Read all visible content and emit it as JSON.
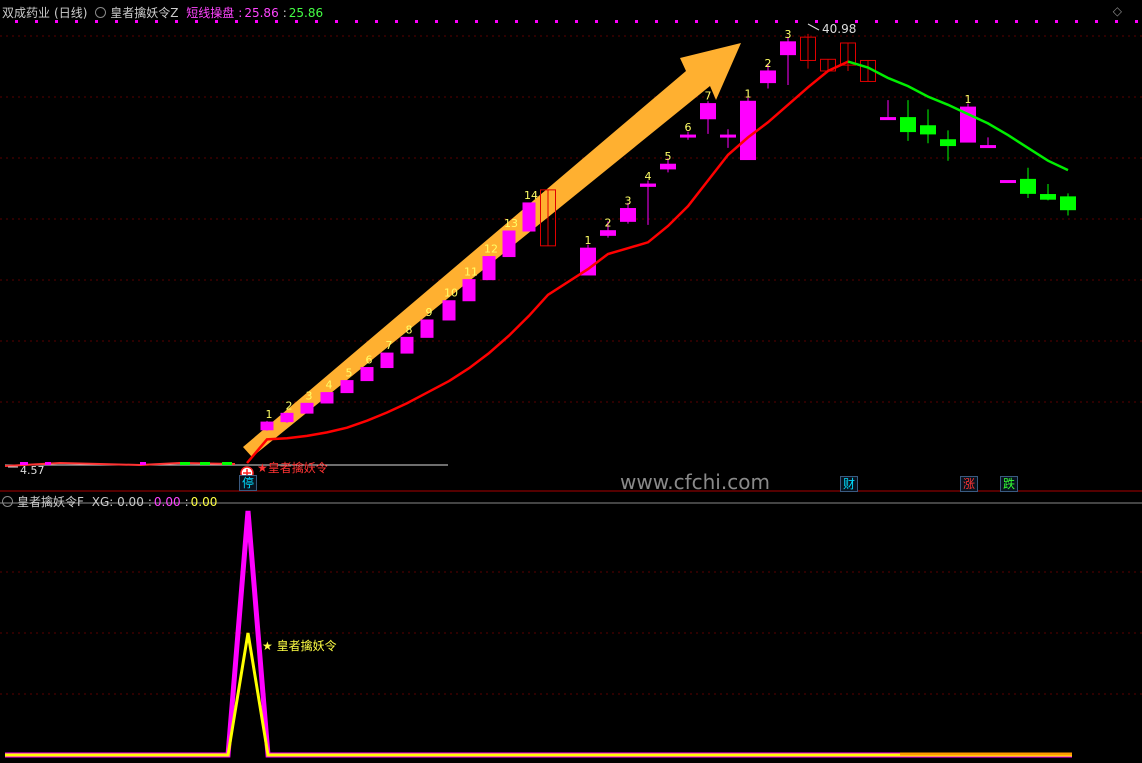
{
  "header": {
    "stock_name": "双成药业",
    "period": "(日线)",
    "indicator_z": "皇者擒妖令Z",
    "short_label": "短线操盘",
    "short_value_1": "25.86",
    "short_value_2": "25.86"
  },
  "sub_header": {
    "indicator_f": "皇者擒妖令F",
    "xg_label": "XG: 0.00",
    "value_2": "0.00",
    "value_3": "0.00"
  },
  "annotations": {
    "high_label": "40.98",
    "low_label": "4.57",
    "signal_label": "★皇者擒妖令",
    "sub_signal_label": "★ 皇者擒妖令",
    "halt_badge": "停",
    "finance_badge": "财",
    "rise_badge": "涨",
    "fall_badge": "跌",
    "watermark": "www.cfchi.com"
  },
  "colors": {
    "background": "#000000",
    "grid": "#5a0000",
    "up_candle": "#ff00ff",
    "down_candle": "#00ff00",
    "ma_up": "#ff0000",
    "ma_down": "#00ee00",
    "arrow": "#ffb030",
    "signal_magenta": "#ff00ff",
    "signal_yellow": "#ffff00"
  },
  "chart_data": [
    {
      "type": "candlestick",
      "title": "双成药业 (日线)",
      "ylim": [
        4.0,
        42.0
      ],
      "grid": true,
      "candles": [
        {
          "open": 7.02,
          "close": 7.68,
          "high": 7.78,
          "low": 6.94,
          "count": "1"
        },
        {
          "open": 7.72,
          "close": 8.43,
          "high": 8.49,
          "low": 7.6,
          "count": "2"
        },
        {
          "open": 8.45,
          "close": 9.29,
          "high": 9.29,
          "low": 8.45,
          "count": "3"
        },
        {
          "open": 9.32,
          "close": 10.21,
          "high": 10.21,
          "low": 9.32,
          "count": "4"
        },
        {
          "open": 10.21,
          "close": 11.24,
          "high": 11.24,
          "low": 10.21,
          "count": "5"
        },
        {
          "open": 11.24,
          "close": 12.36,
          "high": 12.36,
          "low": 11.24,
          "count": "6"
        },
        {
          "open": 12.36,
          "close": 13.6,
          "high": 13.6,
          "low": 12.36,
          "count": "7"
        },
        {
          "open": 13.6,
          "close": 14.95,
          "high": 14.95,
          "low": 13.6,
          "count": "8"
        },
        {
          "open": 14.95,
          "close": 16.44,
          "high": 16.44,
          "low": 14.95,
          "count": "9"
        },
        {
          "open": 16.44,
          "close": 18.09,
          "high": 18.09,
          "low": 16.44,
          "count": "10"
        },
        {
          "open": 18.09,
          "close": 19.9,
          "high": 19.9,
          "low": 18.09,
          "count": "11"
        },
        {
          "open": 19.9,
          "close": 21.88,
          "high": 21.88,
          "low": 19.9,
          "count": "12"
        },
        {
          "open": 21.88,
          "close": 24.07,
          "high": 24.07,
          "low": 21.88,
          "count": "13"
        },
        {
          "open": 24.07,
          "close": 26.48,
          "high": 26.48,
          "low": 24.07,
          "count": "14"
        },
        {
          "open": 27.6,
          "close": 22.8,
          "high": 27.6,
          "low": 22.8,
          "count": ""
        },
        {
          "open": 20.3,
          "close": 22.6,
          "high": 22.9,
          "low": 20.3,
          "count": "1"
        },
        {
          "open": 23.7,
          "close": 24.1,
          "high": 24.9,
          "low": 23.5,
          "count": "2"
        },
        {
          "open": 24.9,
          "close": 26.0,
          "high": 26.5,
          "low": 24.7,
          "count": "3"
        },
        {
          "open": 27.9,
          "close": 28.1,
          "high": 28.4,
          "low": 24.6,
          "count": "4"
        },
        {
          "open": 29.4,
          "close": 29.8,
          "high": 30.3,
          "low": 29.1,
          "count": "5"
        },
        {
          "open": 32.2,
          "close": 32.3,
          "high": 32.6,
          "low": 31.9,
          "count": "6"
        },
        {
          "open": 33.7,
          "close": 35.0,
          "high": 35.2,
          "low": 32.4,
          "count": "7"
        },
        {
          "open": 32.3,
          "close": 32.2,
          "high": 32.8,
          "low": 31.2,
          "count": ""
        },
        {
          "open": 30.2,
          "close": 35.2,
          "high": 35.5,
          "low": 30.2,
          "count": "1"
        },
        {
          "open": 36.8,
          "close": 37.8,
          "high": 38.4,
          "low": 36.3,
          "count": "2"
        },
        {
          "open": 39.2,
          "close": 40.3,
          "high": 40.7,
          "low": 36.6,
          "count": "3"
        },
        {
          "open": 40.7,
          "close": 38.7,
          "high": 40.98,
          "low": 38.0,
          "count": ""
        },
        {
          "open": 38.8,
          "close": 37.8,
          "high": 38.8,
          "low": 37.8,
          "count": ""
        },
        {
          "open": 40.2,
          "close": 38.3,
          "high": 40.2,
          "low": 37.8,
          "count": ""
        },
        {
          "open": 38.7,
          "close": 36.9,
          "high": 38.7,
          "low": 36.9,
          "count": ""
        },
        {
          "open": 33.8,
          "close": 33.8,
          "high": 35.3,
          "low": 33.8,
          "count": ""
        },
        {
          "open": 33.8,
          "close": 32.6,
          "high": 35.3,
          "low": 31.8,
          "count": ""
        },
        {
          "open": 33.1,
          "close": 32.4,
          "high": 34.5,
          "low": 31.6,
          "count": ""
        },
        {
          "open": 31.9,
          "close": 31.4,
          "high": 32.7,
          "low": 30.1,
          "count": ""
        },
        {
          "open": 31.7,
          "close": 34.7,
          "high": 35.0,
          "low": 31.7,
          "count": "1"
        },
        {
          "open": 31.4,
          "close": 31.4,
          "high": 32.1,
          "low": 31.4,
          "count": ""
        },
        {
          "open": 28.4,
          "close": 28.4,
          "high": 28.4,
          "low": 28.4,
          "count": ""
        },
        {
          "open": 28.5,
          "close": 27.3,
          "high": 29.5,
          "low": 26.9,
          "count": ""
        },
        {
          "open": 27.2,
          "close": 26.8,
          "high": 28.1,
          "low": 26.7,
          "count": ""
        },
        {
          "open": 27.0,
          "close": 25.9,
          "high": 27.3,
          "low": 25.4,
          "count": ""
        }
      ],
      "ma_line": [
        6.2,
        6.3,
        6.5,
        6.8,
        7.2,
        7.8,
        8.5,
        9.3,
        10.2,
        11.2,
        12.3,
        13.6,
        15.1,
        16.8,
        18.6,
        20.8,
        22.1,
        22.6,
        23.1,
        24.5,
        26.2,
        28.4,
        30.6,
        32.1,
        33.4,
        34.9,
        36.4,
        37.8,
        38.6,
        38.1,
        37.2,
        36.5,
        35.6,
        34.9,
        34.1,
        33.3,
        32.3,
        31.2,
        30.1,
        29.3
      ],
      "annotations": [
        "40.98",
        "4.57",
        "★皇者擒妖令"
      ]
    },
    {
      "type": "line",
      "title": "皇者擒妖令F",
      "ylim": [
        0,
        100
      ],
      "series": [
        {
          "name": "",
          "color": "#ff00ff",
          "values": [
            0,
            0,
            0,
            0,
            0,
            100,
            0,
            0,
            0,
            0
          ]
        },
        {
          "name": "",
          "color": "#ffff00",
          "values": [
            0,
            0,
            0,
            0,
            0,
            50,
            0,
            0,
            0,
            0
          ]
        }
      ]
    }
  ]
}
